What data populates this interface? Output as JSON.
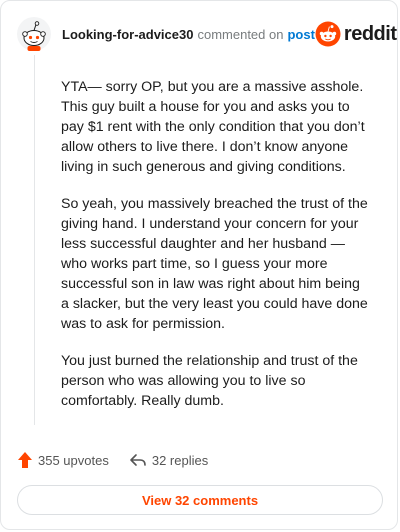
{
  "comment": {
    "author": "Looking-for-advice30",
    "action_text": "commented on",
    "post_link": "post",
    "brand": "reddit",
    "paragraphs": [
      "YTA— sorry OP, but you are a massive asshole. This guy built a house for you and asks you to pay $1 rent with the only condition that you don’t allow others to live there. I don’t know anyone living in such generous and giving conditions.",
      "So yeah, you massively breached the trust of the giving hand. I understand your concern for your less successful daughter and her husband —who works part time, so I guess your more successful son in law was right about him being a slacker, but the very least you could have done was to ask for permission.",
      "You just burned the relationship and trust of the person who was allowing you to live so comfortably. Really dumb."
    ],
    "upvotes": "355 upvotes",
    "replies": "32 replies",
    "view_button": "View 32 comments"
  },
  "icons": {
    "avatar": "snoo-avatar-icon",
    "brand_logo": "reddit-logo-icon",
    "upvote": "upvote-arrow-icon",
    "reply": "reply-arrow-icon"
  },
  "colors": {
    "accent": "#ff4500",
    "link": "#0079d3",
    "muted": "#787c7e"
  }
}
